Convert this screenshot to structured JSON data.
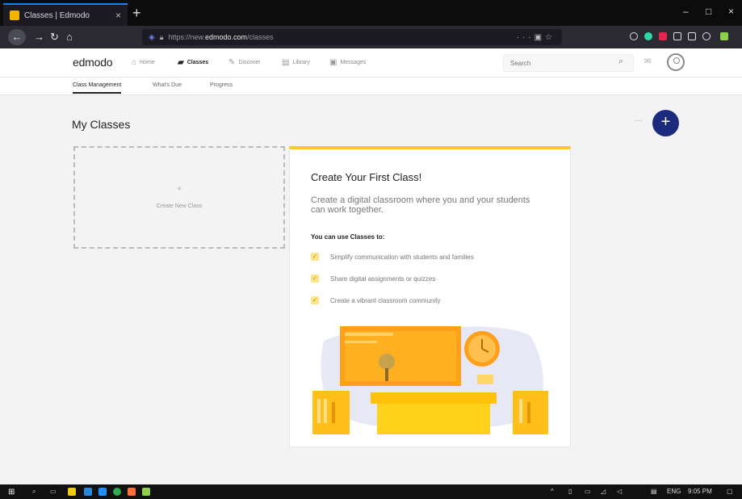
{
  "browser": {
    "tab_title": "Classes | Edmodo",
    "tab_close": "×",
    "new_tab": "+",
    "minimize": "–",
    "maximize": "□",
    "close": "×",
    "url_prefix": "https://new.",
    "url_domain": "edmodo.com",
    "url_path": "/classes",
    "nav": {
      "back": "←",
      "forward": "→",
      "reload": "↻",
      "home": "⌂"
    }
  },
  "app": {
    "logo": "edmodo",
    "nav": [
      {
        "label": "Home",
        "icon": "home-icon"
      },
      {
        "label": "Classes",
        "icon": "classes-icon"
      },
      {
        "label": "Discover",
        "icon": "discover-icon"
      },
      {
        "label": "Library",
        "icon": "library-icon"
      },
      {
        "label": "Messages",
        "icon": "messages-icon"
      }
    ],
    "search_placeholder": "Search"
  },
  "subnav": [
    "Class Management",
    "What's Due",
    "Progress"
  ],
  "main": {
    "title": "My Classes",
    "more": "···",
    "fab": "+",
    "create_card": {
      "plus": "+",
      "label": "Create New Class"
    },
    "info_card": {
      "title": "Create Your First Class!",
      "description": "Create a digital classroom where you and your students can work together.",
      "subheading": "You can use Classes to:",
      "bullets": [
        "Simplify communication with students and families",
        "Share digital assignments or quizzes",
        "Create a vibrant classroom community"
      ],
      "check": "✓"
    }
  },
  "taskbar": {
    "language": "ENG",
    "time": "9:05 PM"
  },
  "colors": {
    "accent_yellow": "#ffc72c",
    "fab_navy": "#1c2a7d",
    "firefox_blue": "#0a84ff"
  }
}
